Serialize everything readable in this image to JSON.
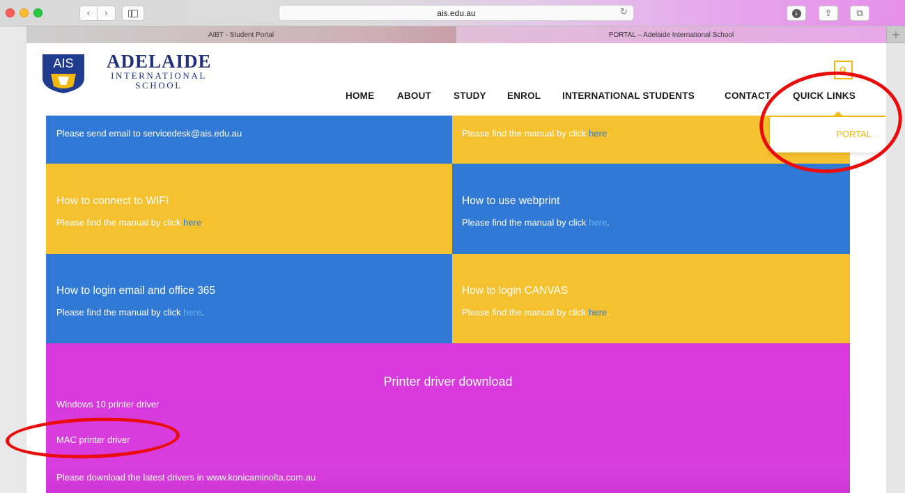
{
  "browser": {
    "address": "ais.edu.au",
    "tabs": [
      {
        "label": "AIBT - Student Portal"
      },
      {
        "label": "PORTAL – Adelaide International School"
      }
    ],
    "new_tab_glyph": "+",
    "back_glyph": "‹",
    "forward_glyph": "›",
    "reload_glyph": "↻",
    "share_glyph": "⇪",
    "tabs_glyph": "⧉",
    "download_glyph": "↓"
  },
  "site": {
    "logo": {
      "crest_text": "AIS",
      "line1": "ADELAIDE",
      "line2": "INTERNATIONAL",
      "line3": "SCHOOL"
    },
    "nav": [
      "HOME",
      "ABOUT",
      "STUDY",
      "ENROL",
      "INTERNATIONAL STUDENTS",
      "CONTACT",
      "QUICK LINKS"
    ],
    "dropdown": {
      "portal_label": "PORTAL"
    }
  },
  "tiles": {
    "support_desc_prefix": "Please send email to servicedesk@ais.edu.au",
    "top_right_desc": "Please find the manual by click ",
    "top_right_link": "here",
    "wifi_title": "How to connect to WIFI",
    "wifi_desc": "Please find the manual by click ",
    "wifi_link": "here",
    "webprint_title": "How to use webprint",
    "webprint_desc": "Please find the manual by click ",
    "webprint_link": "here",
    "email_title": "How to login email and office 365",
    "email_desc": "Please find the manual by click ",
    "email_link": "here",
    "canvas_title": "How to login CANVAS",
    "canvas_desc": "Please find the manual by click ",
    "canvas_link": "here",
    "period": "."
  },
  "printer": {
    "title": "Printer driver download",
    "win10": "Windows 10 printer driver",
    "mac": "MAC printer driver",
    "latest": "Please download the latest drivers in www.konicaminolta.com.au"
  },
  "colors": {
    "blue_tile": "#3079d5",
    "yellow_tile": "#f6c12e",
    "magenta_section": "#d839dd",
    "annotation": "#ea0b0b",
    "brand_navy": "#1f2f7a"
  }
}
